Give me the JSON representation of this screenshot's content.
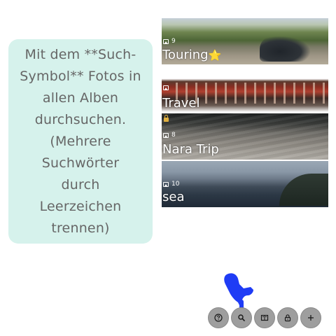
{
  "hint": {
    "text": "Mit dem **Such-\nSymbol** Fotos in\nallen Alben\ndurchsuchen.\n(Mehrere\nSuchwörter\ndurch\nLeerzeichen\ntrennen)"
  },
  "albums": [
    {
      "title": "Touring",
      "title_suffix": "⭐",
      "count": "9",
      "locked": false
    },
    {
      "title": "Travel",
      "count": "",
      "locked": false
    },
    {
      "title": "Nara Trip",
      "count": "8",
      "locked": true
    },
    {
      "title": "sea",
      "count": "10",
      "locked": false
    }
  ],
  "toolbar": {
    "buttons": [
      {
        "name": "help",
        "icon": "help-icon"
      },
      {
        "name": "search",
        "icon": "search-icon"
      },
      {
        "name": "album-view",
        "icon": "album-icon"
      },
      {
        "name": "lock",
        "icon": "lock-icon"
      },
      {
        "name": "add",
        "icon": "plus-icon"
      }
    ]
  },
  "colors": {
    "hint_bg": "#d6f2ec",
    "hint_text": "#666666",
    "toolbar_button": "#9e9e9e",
    "cursor": "#1f3cf5"
  }
}
